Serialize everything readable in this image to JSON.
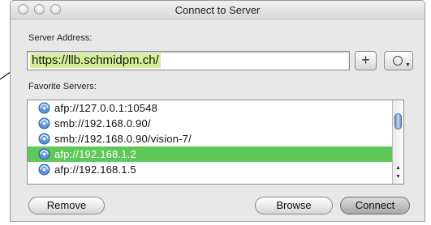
{
  "window": {
    "title": "Connect to Server"
  },
  "server_address": {
    "label": "Server Address:",
    "value": "https://llb.schmidpm.ch/"
  },
  "buttons": {
    "add": "+",
    "remove": "Remove",
    "browse": "Browse",
    "connect": "Connect"
  },
  "favorites": {
    "label": "Favorite Servers:",
    "items": [
      {
        "text": "afp://127.0.0.1:10548",
        "selected": false
      },
      {
        "text": "smb://192.168.0.90/",
        "selected": false
      },
      {
        "text": "smb://192.168.0.90/vision-7/",
        "selected": false
      },
      {
        "text": "afp://192.168.1.2",
        "selected": true
      },
      {
        "text": "afp://192.168.1.5",
        "selected": false
      }
    ]
  },
  "colors": {
    "selection": "#5ec858",
    "address_highlight": "#d6f09a"
  },
  "icons": {
    "server": "server-globe-icon",
    "recent": "clock-icon"
  }
}
